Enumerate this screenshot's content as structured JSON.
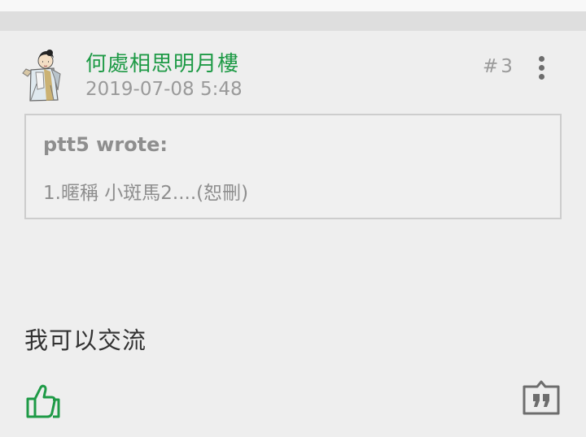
{
  "post": {
    "author": "何處相思明月樓",
    "date": "2019-07-08 5:48",
    "floor": "#3",
    "quote": {
      "author": "ptt5 wrote:",
      "text": "1.暱稱 小斑馬2....(恕刪)"
    },
    "content": "我可以交流"
  },
  "icons": {
    "avatar": "avatar-illustration",
    "more": "more-vertical-icon",
    "like": "thumbs-up-icon",
    "quote": "quote-reply-icon"
  },
  "colors": {
    "author": "#1e9a46",
    "like": "#1e9a46",
    "muted": "#9a9a9a",
    "background": "#eeeeee"
  }
}
